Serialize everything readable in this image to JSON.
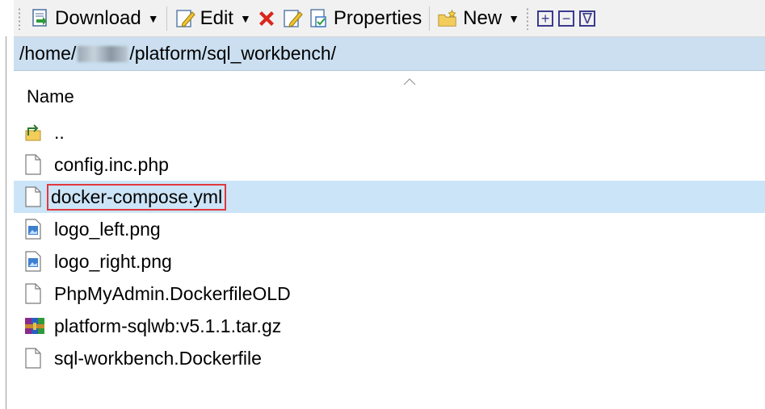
{
  "toolbar": {
    "download_label": "Download",
    "edit_label": "Edit",
    "properties_label": "Properties",
    "new_label": "New",
    "plus_glyph": "+",
    "minus_glyph": "−",
    "filter_glyph": "∇"
  },
  "path": {
    "prefix": "/home/",
    "suffix": "/platform/sql_workbench/"
  },
  "columns": {
    "name": "Name"
  },
  "files": [
    {
      "name": "..",
      "icon": "parent-folder-icon"
    },
    {
      "name": "config.inc.php",
      "icon": "file-icon"
    },
    {
      "name": "docker-compose.yml",
      "icon": "file-icon",
      "selected": true
    },
    {
      "name": "logo_left.png",
      "icon": "image-file-icon"
    },
    {
      "name": "logo_right.png",
      "icon": "image-file-icon"
    },
    {
      "name": "PhpMyAdmin.DockerfileOLD",
      "icon": "file-icon"
    },
    {
      "name": "platform-sqlwb:v5.1.1.tar.gz",
      "icon": "archive-icon"
    },
    {
      "name": "sql-workbench.Dockerfile",
      "icon": "file-icon"
    }
  ],
  "colors": {
    "selection": "#cce4f7",
    "path_bar": "#cbdff0",
    "highlight_box": "#e0393e"
  }
}
